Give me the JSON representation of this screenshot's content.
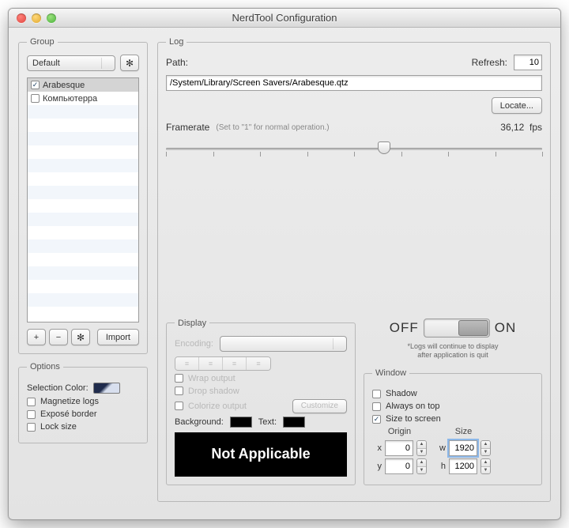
{
  "window": {
    "title": "NerdTool Configuration"
  },
  "group": {
    "legend": "Group",
    "dropdown_value": "Default",
    "items": [
      {
        "checked": true,
        "label": "Arabesque",
        "selected": true
      },
      {
        "checked": false,
        "label": "Компьютерра",
        "selected": false
      }
    ],
    "btn_add": "+",
    "btn_remove": "−",
    "btn_gear": "gear-icon",
    "btn_import": "Import"
  },
  "options": {
    "legend": "Options",
    "selection_color_label": "Selection Color:",
    "magnetize": {
      "label": "Magnetize logs",
      "checked": false
    },
    "expose": {
      "label": "Exposé border",
      "checked": false
    },
    "lock": {
      "label": "Lock size",
      "checked": false
    }
  },
  "log": {
    "legend": "Log",
    "path_label": "Path:",
    "refresh_label": "Refresh:",
    "refresh_value": "10",
    "path_value": "/System/Library/Screen Savers/Arabesque.qtz",
    "locate_label": "Locate...",
    "framerate_label": "Framerate",
    "framerate_hint": "(Set to \"1\" for normal operation.)",
    "fps_value": "36,12",
    "fps_unit": "fps"
  },
  "display": {
    "legend": "Display",
    "encoding_label": "Encoding:",
    "wrap": {
      "label": "Wrap output",
      "checked": false
    },
    "drop": {
      "label": "Drop shadow",
      "checked": false
    },
    "colorize": {
      "label": "Colorize output",
      "checked": false
    },
    "customize_label": "Customize",
    "background_label": "Background:",
    "text_label": "Text:",
    "not_applicable": "Not Applicable"
  },
  "toggle": {
    "off": "OFF",
    "on": "ON",
    "note_line1": "*Logs will continue to display",
    "note_line2": "after application is quit"
  },
  "winpanel": {
    "legend": "Window",
    "shadow": {
      "label": "Shadow",
      "checked": false
    },
    "ontop": {
      "label": "Always on top",
      "checked": false
    },
    "size2scr": {
      "label": "Size to screen",
      "checked": true
    },
    "origin_label": "Origin",
    "size_label": "Size",
    "x": "0",
    "y": "0",
    "w": "1920",
    "h": "1200"
  }
}
